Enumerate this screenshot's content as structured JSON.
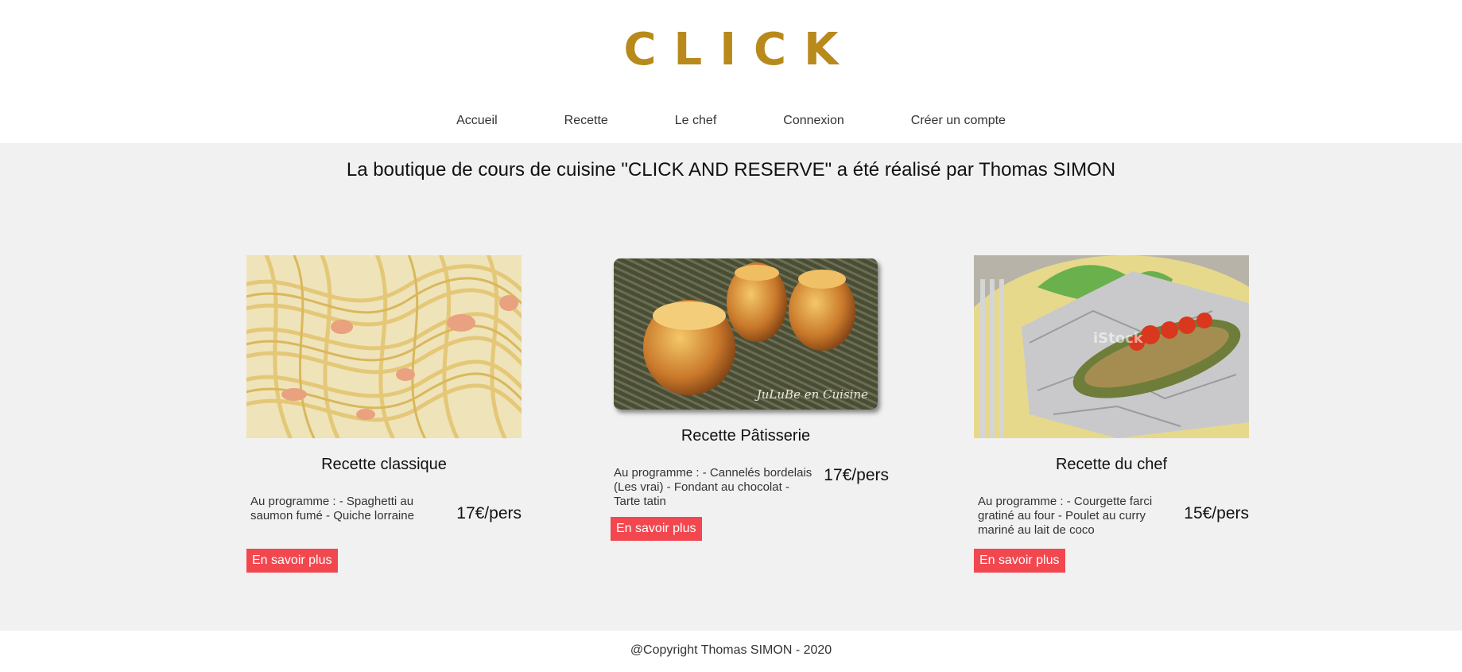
{
  "brand": {
    "logo_text": "CLICK",
    "accent": "#b88a1b"
  },
  "nav": {
    "items": [
      {
        "label": "Accueil"
      },
      {
        "label": "Recette"
      },
      {
        "label": "Le chef"
      },
      {
        "label": "Connexion"
      },
      {
        "label": "Créer un compte"
      }
    ]
  },
  "main": {
    "intro": "La boutique de cours de cuisine \"CLICK AND RESERVE\" a été réalisé par Thomas SIMON",
    "background": "#f1f1f1",
    "cards": [
      {
        "image": "spaghetti-photo",
        "title": "Recette classique",
        "description": "Au programme : - Spaghetti au saumon fumé - Quiche lorraine",
        "price": "17€/pers",
        "button": "En savoir plus"
      },
      {
        "image": "canneles-photo",
        "image_caption": "JuLuBe en Cuisine",
        "title": "Recette Pâtisserie",
        "description": "Au programme : - Cannelés bordelais (Les vrai) - Fondant au chocolat - Tarte tatin",
        "price": "17€/pers",
        "button": "En savoir plus"
      },
      {
        "image": "stuffed-zucchini-photo",
        "image_watermark": "iStock",
        "title": "Recette du chef",
        "description": "Au programme : - Courgette farci gratiné au four - Poulet au curry mariné au lait de coco",
        "price": "15€/pers",
        "button": "En savoir plus"
      }
    ],
    "button_color": "#f2474f"
  },
  "footer": {
    "text": "@Copyright Thomas SIMON - 2020"
  }
}
